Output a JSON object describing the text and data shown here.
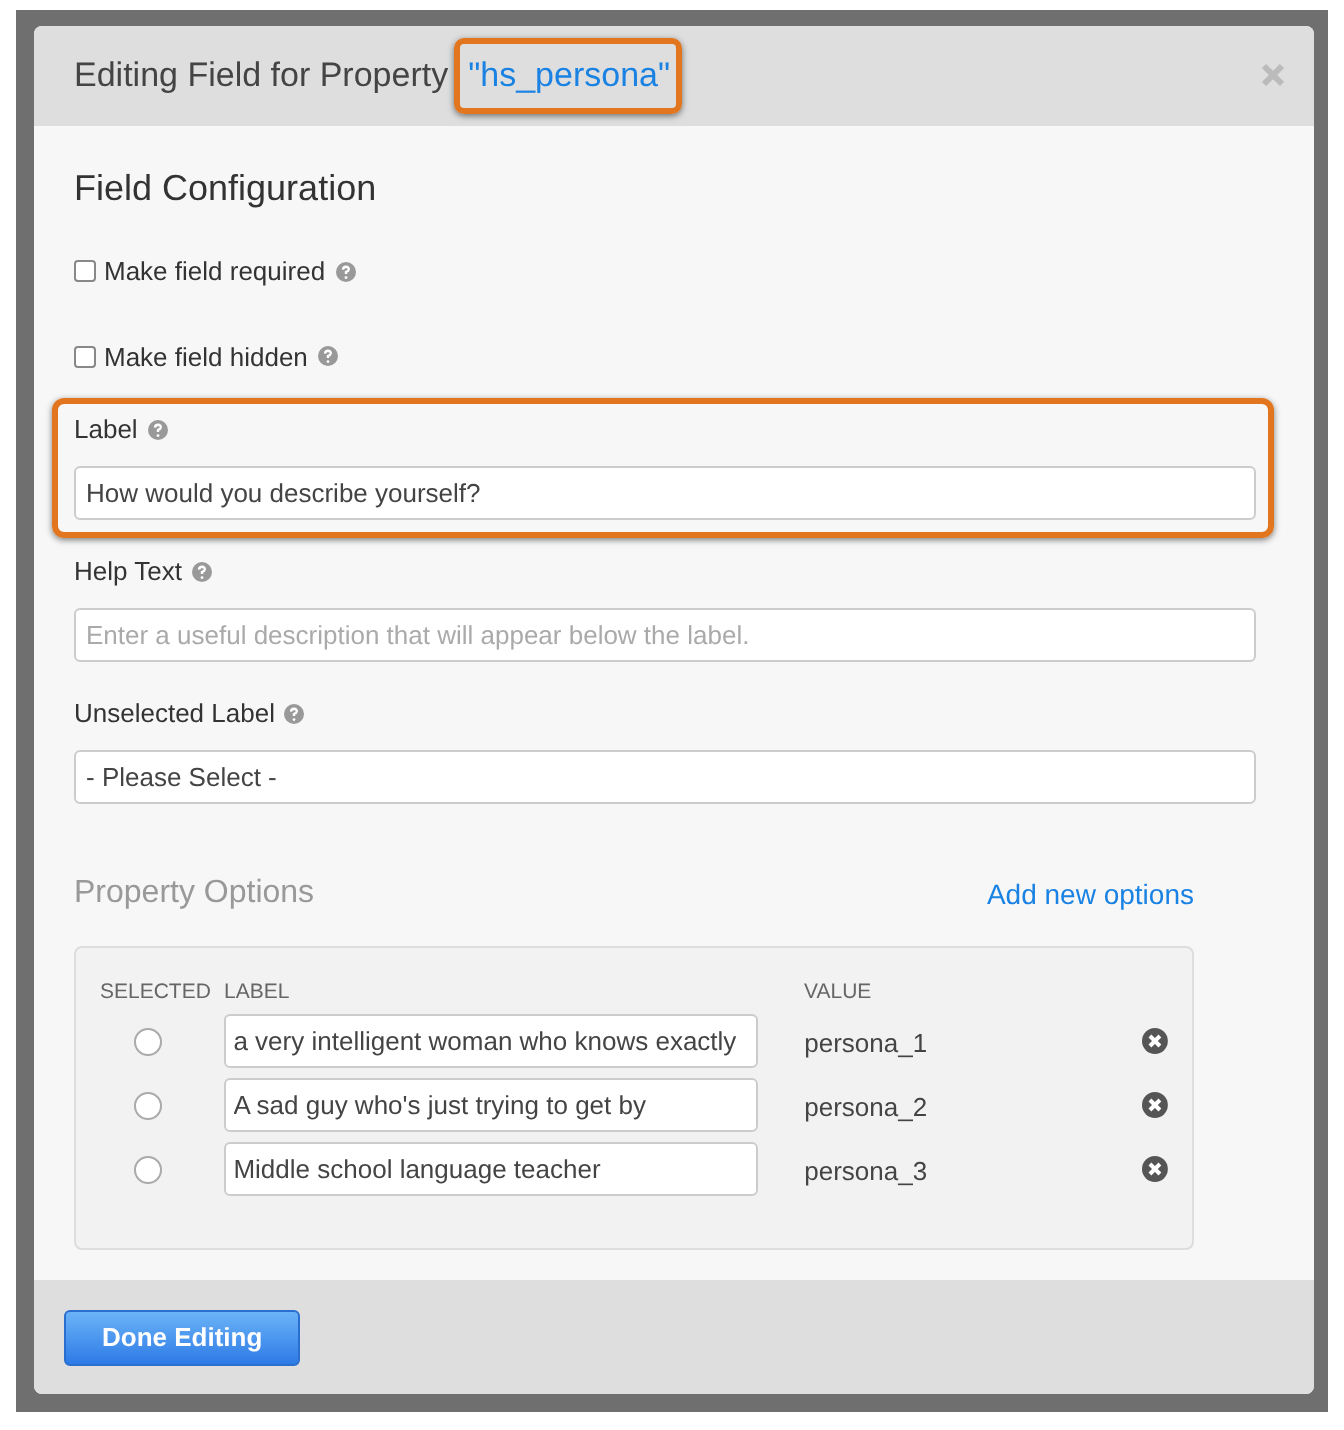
{
  "dialog": {
    "title": "Editing Field for Property",
    "property_name": "\"hs_persona\""
  },
  "section_title": "Field Configuration",
  "checkboxes": [
    {
      "label": "Make field required",
      "checked": false
    },
    {
      "label": "Make field hidden",
      "checked": false
    }
  ],
  "fields": [
    {
      "label": "Label",
      "value": "How would you describe yourself?",
      "highlighted": true
    },
    {
      "label": "Help Text",
      "placeholder": "Enter a useful description that will appear below the label.",
      "highlighted": false
    },
    {
      "label": "Unselected Label",
      "value": "- Please Select -",
      "highlighted": false
    }
  ],
  "property_options": {
    "title": "Property Options",
    "add_link": "Add new options",
    "columns": [
      "SELECTED",
      "LABEL",
      "VALUE"
    ],
    "rows": [
      {
        "selected": false,
        "label": "a very intelligent woman who knows exactly",
        "value": "persona_1"
      },
      {
        "selected": false,
        "label": "A sad guy who's just trying to get by",
        "value": "persona_2"
      },
      {
        "selected": false,
        "label": "Middle school language teacher",
        "value": "persona_3"
      }
    ]
  },
  "footer": {
    "button": "Done Editing"
  }
}
